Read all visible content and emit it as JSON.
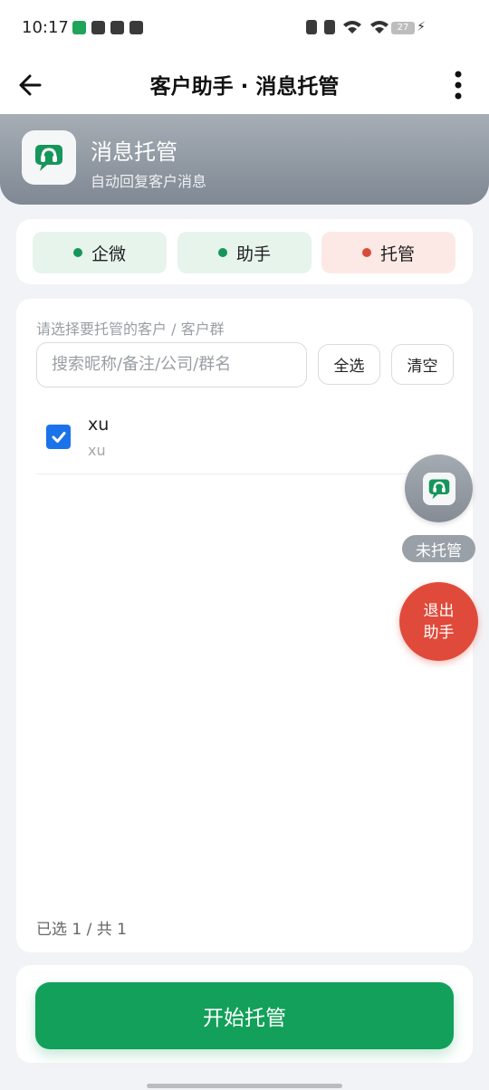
{
  "status_bar": {
    "time": "10:17",
    "battery": "27"
  },
  "top_bar": {
    "title": "客户助手 · 消息托管"
  },
  "header": {
    "title": "消息托管",
    "subtitle": "自动回复客户消息"
  },
  "status_pills": [
    {
      "label": "企微",
      "state_color": "#16965a"
    },
    {
      "label": "助手",
      "state_color": "#16965a"
    },
    {
      "label": "托管",
      "state_color": "#dc4a3a"
    }
  ],
  "picker": {
    "hint": "请选择要托管的客户 / 客户群",
    "search_placeholder": "搜索昵称/备注/公司/群名",
    "select_all_label": "全选",
    "clear_label": "清空",
    "items": [
      {
        "name": "xu",
        "sub": "xu",
        "checked": true
      }
    ],
    "count_text": "已选 1 / 共 1"
  },
  "floating": {
    "status_label": "未托管",
    "exit_line1": "退出",
    "exit_line2": "助手"
  },
  "footer": {
    "start_label": "开始托管"
  },
  "colors": {
    "accent_green": "#12a05a",
    "danger_red": "#e04a3a",
    "check_blue": "#1a73e8"
  }
}
